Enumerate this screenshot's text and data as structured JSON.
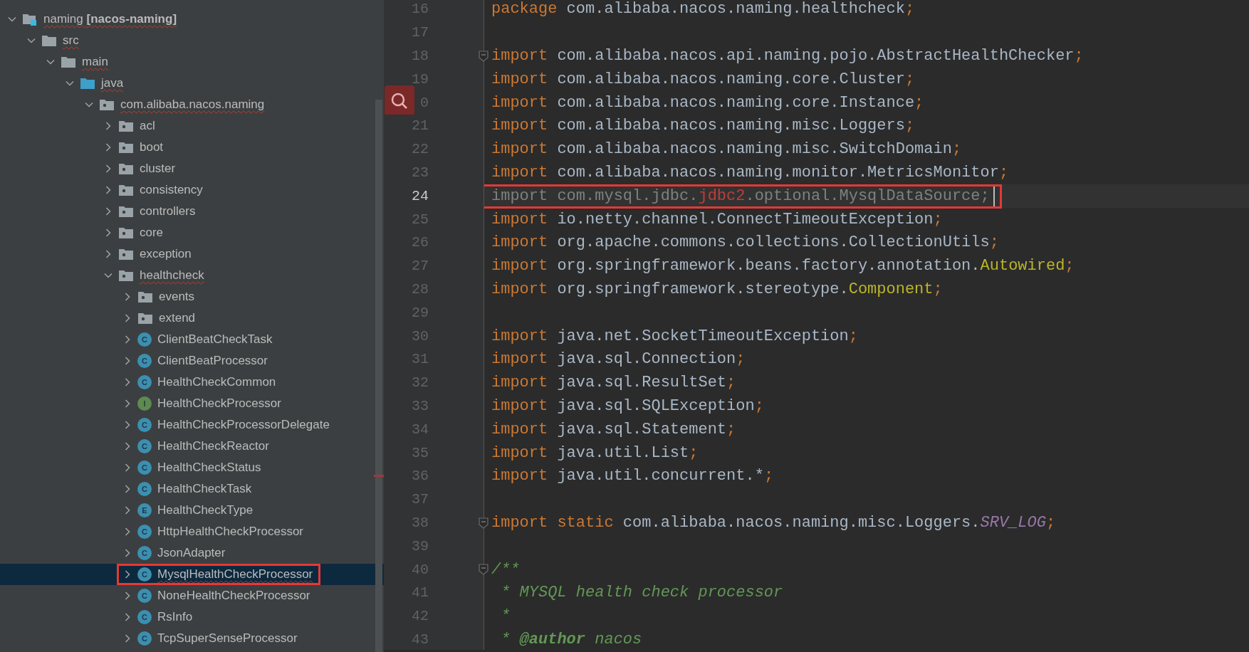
{
  "project_tree": [
    {
      "label": "naming **[nacos-naming]**",
      "kind": "module",
      "expanded": true,
      "selected": false,
      "boxed": false,
      "typo": true,
      "children": [
        {
          "label": "src",
          "kind": "folder",
          "expanded": true,
          "selected": false,
          "boxed": false,
          "typo": true,
          "children": [
            {
              "label": "main",
              "kind": "folder",
              "expanded": true,
              "selected": false,
              "boxed": false,
              "typo": true,
              "children": [
                {
                  "label": "java",
                  "kind": "source-folder",
                  "expanded": true,
                  "selected": false,
                  "boxed": false,
                  "typo": true,
                  "children": [
                    {
                      "label": "com.alibaba.nacos.naming",
                      "kind": "package",
                      "expanded": true,
                      "selected": false,
                      "boxed": false,
                      "typo": true,
                      "children": [
                        {
                          "label": "acl",
                          "kind": "package",
                          "expanded": false,
                          "selected": false,
                          "boxed": false,
                          "typo": false
                        },
                        {
                          "label": "boot",
                          "kind": "package",
                          "expanded": false,
                          "selected": false,
                          "boxed": false,
                          "typo": false
                        },
                        {
                          "label": "cluster",
                          "kind": "package",
                          "expanded": false,
                          "selected": false,
                          "boxed": false,
                          "typo": false
                        },
                        {
                          "label": "consistency",
                          "kind": "package",
                          "expanded": false,
                          "selected": false,
                          "boxed": false,
                          "typo": false
                        },
                        {
                          "label": "controllers",
                          "kind": "package",
                          "expanded": false,
                          "selected": false,
                          "boxed": false,
                          "typo": false
                        },
                        {
                          "label": "core",
                          "kind": "package",
                          "expanded": false,
                          "selected": false,
                          "boxed": false,
                          "typo": false
                        },
                        {
                          "label": "exception",
                          "kind": "package",
                          "expanded": false,
                          "selected": false,
                          "boxed": false,
                          "typo": false
                        },
                        {
                          "label": "healthcheck",
                          "kind": "package",
                          "expanded": true,
                          "selected": false,
                          "boxed": false,
                          "typo": true,
                          "children": [
                            {
                              "label": "events",
                              "kind": "package",
                              "expanded": false,
                              "selected": false,
                              "boxed": false,
                              "typo": false
                            },
                            {
                              "label": "extend",
                              "kind": "package",
                              "expanded": false,
                              "selected": false,
                              "boxed": false,
                              "typo": false
                            },
                            {
                              "label": "ClientBeatCheckTask",
                              "kind": "class",
                              "letter": "C",
                              "expanded": false,
                              "selected": false,
                              "boxed": false,
                              "typo": false
                            },
                            {
                              "label": "ClientBeatProcessor",
                              "kind": "class",
                              "letter": "C",
                              "expanded": false,
                              "selected": false,
                              "boxed": false,
                              "typo": false
                            },
                            {
                              "label": "HealthCheckCommon",
                              "kind": "class",
                              "letter": "C",
                              "expanded": false,
                              "selected": false,
                              "boxed": false,
                              "typo": false
                            },
                            {
                              "label": "HealthCheckProcessor",
                              "kind": "interface",
                              "letter": "I",
                              "expanded": false,
                              "selected": false,
                              "boxed": false,
                              "typo": false
                            },
                            {
                              "label": "HealthCheckProcessorDelegate",
                              "kind": "class",
                              "letter": "C",
                              "expanded": false,
                              "selected": false,
                              "boxed": false,
                              "typo": false
                            },
                            {
                              "label": "HealthCheckReactor",
                              "kind": "class",
                              "letter": "C",
                              "expanded": false,
                              "selected": false,
                              "boxed": false,
                              "typo": false
                            },
                            {
                              "label": "HealthCheckStatus",
                              "kind": "class",
                              "letter": "C",
                              "expanded": false,
                              "selected": false,
                              "boxed": false,
                              "typo": false
                            },
                            {
                              "label": "HealthCheckTask",
                              "kind": "class",
                              "letter": "C",
                              "expanded": false,
                              "selected": false,
                              "boxed": false,
                              "typo": false
                            },
                            {
                              "label": "HealthCheckType",
                              "kind": "enum",
                              "letter": "E",
                              "expanded": false,
                              "selected": false,
                              "boxed": false,
                              "typo": false
                            },
                            {
                              "label": "HttpHealthCheckProcessor",
                              "kind": "class",
                              "letter": "C",
                              "expanded": false,
                              "selected": false,
                              "boxed": false,
                              "typo": false
                            },
                            {
                              "label": "JsonAdapter",
                              "kind": "class",
                              "letter": "C",
                              "expanded": false,
                              "selected": false,
                              "boxed": false,
                              "typo": false
                            },
                            {
                              "label": "MysqlHealthCheckProcessor",
                              "kind": "class",
                              "letter": "C",
                              "expanded": false,
                              "selected": true,
                              "boxed": true,
                              "typo": true
                            },
                            {
                              "label": "NoneHealthCheckProcessor",
                              "kind": "class",
                              "letter": "C",
                              "expanded": false,
                              "selected": false,
                              "boxed": false,
                              "typo": false
                            },
                            {
                              "label": "RsInfo",
                              "kind": "class",
                              "letter": "C",
                              "expanded": false,
                              "selected": false,
                              "boxed": false,
                              "typo": false
                            },
                            {
                              "label": "TcpSuperSenseProcessor",
                              "kind": "class",
                              "letter": "C",
                              "expanded": false,
                              "selected": false,
                              "boxed": false,
                              "typo": false
                            }
                          ]
                        }
                      ]
                    }
                  ]
                }
              ]
            }
          ]
        }
      ]
    }
  ],
  "editor": {
    "lines": [
      {
        "number": "16",
        "current": false,
        "boxed": false,
        "fold": false,
        "caret": false,
        "search_badge": false,
        "segments": [
          {
            "text": "package",
            "kind": "keyword"
          },
          {
            "text": " com.alibaba.nacos.naming.healthcheck",
            "kind": "plain"
          },
          {
            "text": ";",
            "kind": "punct"
          }
        ]
      },
      {
        "number": "17",
        "current": false,
        "boxed": false,
        "fold": false,
        "caret": false,
        "search_badge": false
      },
      {
        "number": "18",
        "current": false,
        "boxed": false,
        "fold": true,
        "caret": false,
        "search_badge": false,
        "segments": [
          {
            "text": "import",
            "kind": "keyword"
          },
          {
            "text": " com.alibaba.nacos.api.naming.pojo.AbstractHealthChecker",
            "kind": "plain"
          },
          {
            "text": ";",
            "kind": "punct"
          }
        ]
      },
      {
        "number": "19",
        "current": false,
        "boxed": false,
        "fold": false,
        "caret": false,
        "search_badge": false,
        "segments": [
          {
            "text": "import",
            "kind": "keyword"
          },
          {
            "text": " com.alibaba.nacos.naming.core.Cluster",
            "kind": "plain"
          },
          {
            "text": ";",
            "kind": "punct"
          }
        ]
      },
      {
        "number": "0",
        "current": false,
        "boxed": false,
        "fold": false,
        "caret": false,
        "search_badge": true,
        "segments": [
          {
            "text": "import",
            "kind": "keyword"
          },
          {
            "text": " com.alibaba.nacos.naming.core.Instance",
            "kind": "plain"
          },
          {
            "text": ";",
            "kind": "punct"
          }
        ]
      },
      {
        "number": "21",
        "current": false,
        "boxed": false,
        "fold": false,
        "caret": false,
        "search_badge": false,
        "segments": [
          {
            "text": "import",
            "kind": "keyword"
          },
          {
            "text": " com.alibaba.nacos.naming.misc.Loggers",
            "kind": "plain"
          },
          {
            "text": ";",
            "kind": "punct"
          }
        ]
      },
      {
        "number": "22",
        "current": false,
        "boxed": false,
        "fold": false,
        "caret": false,
        "search_badge": false,
        "segments": [
          {
            "text": "import",
            "kind": "keyword"
          },
          {
            "text": " com.alibaba.nacos.naming.misc.SwitchDomain",
            "kind": "plain"
          },
          {
            "text": ";",
            "kind": "punct"
          }
        ]
      },
      {
        "number": "23",
        "current": false,
        "boxed": false,
        "fold": false,
        "caret": false,
        "search_badge": false,
        "segments": [
          {
            "text": "import",
            "kind": "keyword"
          },
          {
            "text": " com.alibaba.nacos.naming.monitor.MetricsMonitor",
            "kind": "plain"
          },
          {
            "text": ";",
            "kind": "punct"
          }
        ]
      },
      {
        "number": "24",
        "current": true,
        "boxed": true,
        "fold": false,
        "caret": true,
        "search_badge": false,
        "segments": [
          {
            "text": "import com.mysql.jdbc.",
            "kind": "unused"
          },
          {
            "text": "jdbc2",
            "kind": "error"
          },
          {
            "text": ".optional.MysqlDataSource;",
            "kind": "unused"
          }
        ]
      },
      {
        "number": "25",
        "current": false,
        "boxed": false,
        "fold": false,
        "caret": false,
        "search_badge": false,
        "segments": [
          {
            "text": "import",
            "kind": "keyword"
          },
          {
            "text": " io.netty.channel.ConnectTimeoutException",
            "kind": "plain"
          },
          {
            "text": ";",
            "kind": "punct"
          }
        ]
      },
      {
        "number": "26",
        "current": false,
        "boxed": false,
        "fold": false,
        "caret": false,
        "search_badge": false,
        "segments": [
          {
            "text": "import",
            "kind": "keyword"
          },
          {
            "text": " org.apache.commons.collections.CollectionUtils",
            "kind": "plain"
          },
          {
            "text": ";",
            "kind": "punct"
          }
        ]
      },
      {
        "number": "27",
        "current": false,
        "boxed": false,
        "fold": false,
        "caret": false,
        "search_badge": false,
        "segments": [
          {
            "text": "import",
            "kind": "keyword"
          },
          {
            "text": " org.springframework.beans.factory.annotation.",
            "kind": "plain"
          },
          {
            "text": "Autowired",
            "kind": "annotation"
          },
          {
            "text": ";",
            "kind": "punct"
          }
        ]
      },
      {
        "number": "28",
        "current": false,
        "boxed": false,
        "fold": false,
        "caret": false,
        "search_badge": false,
        "segments": [
          {
            "text": "import",
            "kind": "keyword"
          },
          {
            "text": " org.springframework.stereotype.",
            "kind": "plain"
          },
          {
            "text": "Component",
            "kind": "annotation"
          },
          {
            "text": ";",
            "kind": "punct"
          }
        ]
      },
      {
        "number": "29",
        "current": false,
        "boxed": false,
        "fold": false,
        "caret": false,
        "search_badge": false
      },
      {
        "number": "30",
        "current": false,
        "boxed": false,
        "fold": false,
        "caret": false,
        "search_badge": false,
        "segments": [
          {
            "text": "import",
            "kind": "keyword"
          },
          {
            "text": " java.net.SocketTimeoutException",
            "kind": "plain"
          },
          {
            "text": ";",
            "kind": "punct"
          }
        ]
      },
      {
        "number": "31",
        "current": false,
        "boxed": false,
        "fold": false,
        "caret": false,
        "search_badge": false,
        "segments": [
          {
            "text": "import",
            "kind": "keyword"
          },
          {
            "text": " java.sql.Connection",
            "kind": "plain"
          },
          {
            "text": ";",
            "kind": "punct"
          }
        ]
      },
      {
        "number": "32",
        "current": false,
        "boxed": false,
        "fold": false,
        "caret": false,
        "search_badge": false,
        "segments": [
          {
            "text": "import",
            "kind": "keyword"
          },
          {
            "text": " java.sql.ResultSet",
            "kind": "plain"
          },
          {
            "text": ";",
            "kind": "punct"
          }
        ]
      },
      {
        "number": "33",
        "current": false,
        "boxed": false,
        "fold": false,
        "caret": false,
        "search_badge": false,
        "segments": [
          {
            "text": "import",
            "kind": "keyword"
          },
          {
            "text": " java.sql.SQLException",
            "kind": "plain"
          },
          {
            "text": ";",
            "kind": "punct"
          }
        ]
      },
      {
        "number": "34",
        "current": false,
        "boxed": false,
        "fold": false,
        "caret": false,
        "search_badge": false,
        "segments": [
          {
            "text": "import",
            "kind": "keyword"
          },
          {
            "text": " java.sql.Statement",
            "kind": "plain"
          },
          {
            "text": ";",
            "kind": "punct"
          }
        ]
      },
      {
        "number": "35",
        "current": false,
        "boxed": false,
        "fold": false,
        "caret": false,
        "search_badge": false,
        "segments": [
          {
            "text": "import",
            "kind": "keyword"
          },
          {
            "text": " java.util.List",
            "kind": "plain"
          },
          {
            "text": ";",
            "kind": "punct"
          }
        ]
      },
      {
        "number": "36",
        "current": false,
        "boxed": false,
        "fold": false,
        "caret": false,
        "search_badge": false,
        "segments": [
          {
            "text": "import",
            "kind": "keyword"
          },
          {
            "text": " java.util.concurrent.*",
            "kind": "plain"
          },
          {
            "text": ";",
            "kind": "punct"
          }
        ]
      },
      {
        "number": "37",
        "current": false,
        "boxed": false,
        "fold": false,
        "caret": false,
        "search_badge": false
      },
      {
        "number": "38",
        "current": false,
        "boxed": false,
        "fold": true,
        "caret": false,
        "search_badge": false,
        "segments": [
          {
            "text": "import static",
            "kind": "keyword"
          },
          {
            "text": " com.alibaba.nacos.naming.misc.Loggers.",
            "kind": "plain"
          },
          {
            "text": "SRV_LOG",
            "kind": "static"
          },
          {
            "text": ";",
            "kind": "punct"
          }
        ]
      },
      {
        "number": "39",
        "current": false,
        "boxed": false,
        "fold": false,
        "caret": false,
        "search_badge": false
      },
      {
        "number": "40",
        "current": false,
        "boxed": false,
        "fold": true,
        "caret": false,
        "search_badge": false,
        "segments": [
          {
            "text": "/**",
            "kind": "comment"
          }
        ]
      },
      {
        "number": "41",
        "current": false,
        "boxed": false,
        "fold": false,
        "caret": false,
        "search_badge": false,
        "segments": [
          {
            "text": " * MYSQL health check processor",
            "kind": "comment"
          }
        ]
      },
      {
        "number": "42",
        "current": false,
        "boxed": false,
        "fold": false,
        "caret": false,
        "search_badge": false,
        "segments": [
          {
            "text": " *",
            "kind": "comment"
          }
        ]
      },
      {
        "number": "43",
        "current": false,
        "boxed": false,
        "fold": false,
        "caret": false,
        "search_badge": false,
        "segments": [
          {
            "text": " * ",
            "kind": "comment"
          },
          {
            "text": "@author",
            "kind": "doc_tag"
          },
          {
            "text": " nacos",
            "kind": "comment"
          }
        ]
      }
    ]
  }
}
